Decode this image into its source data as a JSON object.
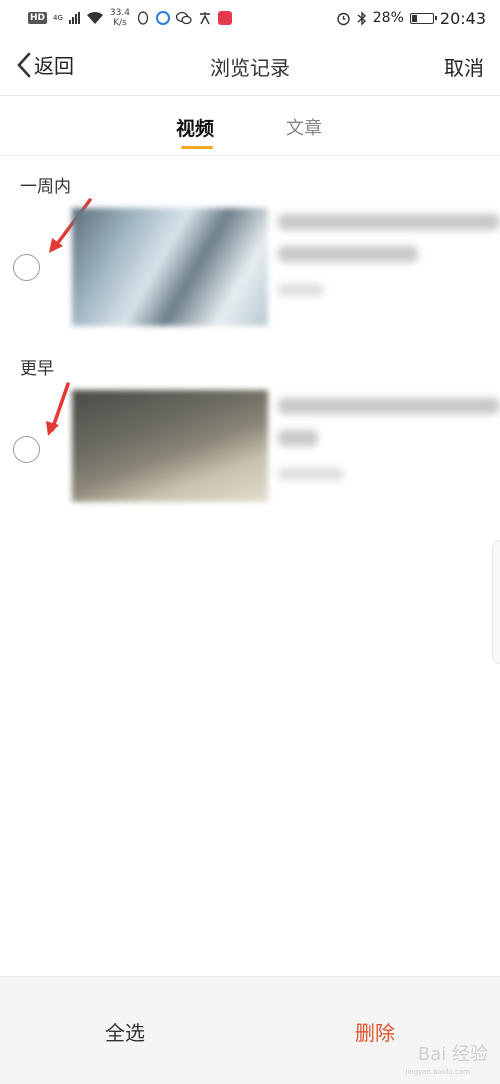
{
  "status_bar": {
    "hd": "HD",
    "net": "4G",
    "speed_value": "33.4",
    "speed_unit": "K/s",
    "battery": "28%",
    "time": "20:43"
  },
  "nav": {
    "back_label": "返回",
    "title": "浏览记录",
    "cancel_label": "取消"
  },
  "tabs": [
    {
      "label": "视频",
      "active": true
    },
    {
      "label": "文章",
      "active": false
    }
  ],
  "sections": [
    {
      "label": "一周内"
    },
    {
      "label": "更早"
    }
  ],
  "bottom": {
    "select_all_label": "全选",
    "delete_label": "删除"
  },
  "watermark": {
    "text": "Bai 经验",
    "sub": "jingyan.baidu.com"
  },
  "colors": {
    "accent_orange": "#f5a623",
    "delete_red": "#e0542d",
    "arrow_red": "#e53935"
  },
  "battery_level": 0.28
}
